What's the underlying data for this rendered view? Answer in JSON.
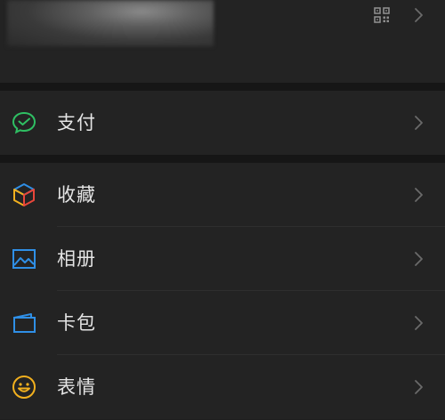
{
  "profile": {
    "avatar_alt": "",
    "qr_icon": "qr-code-icon",
    "chevron_icon": "chevron-right-icon"
  },
  "menu": {
    "pay": {
      "label": "支付",
      "icon": "wechat-pay-icon",
      "color": "#2fbf63"
    },
    "favorites": {
      "label": "收藏",
      "icon": "cube-icon",
      "colors": [
        "#e8463a",
        "#f2b01e",
        "#2f8fe6"
      ]
    },
    "album": {
      "label": "相册",
      "icon": "picture-icon",
      "color": "#2f8fe6"
    },
    "cards": {
      "label": "卡包",
      "icon": "card-wallet-icon",
      "color": "#2f8fe6"
    },
    "stickers": {
      "label": "表情",
      "icon": "smiley-icon",
      "color": "#f2b01e"
    }
  },
  "colors": {
    "background": "#1f1f1f",
    "row": "#232323",
    "gap": "#161616",
    "text": "#e4e4e4",
    "chevron": "#6a6a6a"
  }
}
